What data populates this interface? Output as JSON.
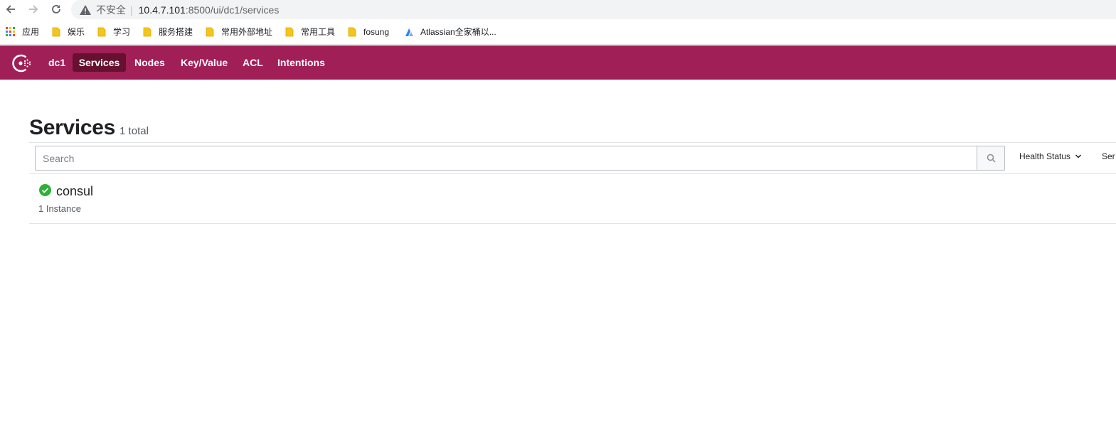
{
  "browser": {
    "security_label": "不安全",
    "separator": "|",
    "url_host": "10.4.7.101",
    "url_path": ":8500/ui/dc1/services",
    "bookmarks": [
      {
        "label": "应用",
        "icon": "apps-grid-icon"
      },
      {
        "label": "娱乐",
        "icon": "folder-icon"
      },
      {
        "label": "学习",
        "icon": "folder-icon"
      },
      {
        "label": "服务搭建",
        "icon": "folder-icon"
      },
      {
        "label": "常用外部地址",
        "icon": "folder-icon"
      },
      {
        "label": "常用工具",
        "icon": "folder-icon"
      },
      {
        "label": "fosung",
        "icon": "folder-icon"
      },
      {
        "label": "Atlassian全家桶以...",
        "icon": "atlassian-icon"
      }
    ]
  },
  "nav": {
    "datacenter": "dc1",
    "items": [
      {
        "label": "Services",
        "active": true
      },
      {
        "label": "Nodes",
        "active": false
      },
      {
        "label": "Key/Value",
        "active": false
      },
      {
        "label": "ACL",
        "active": false
      },
      {
        "label": "Intentions",
        "active": false
      }
    ]
  },
  "page": {
    "title": "Services",
    "count": "1 total"
  },
  "filters": {
    "search_placeholder": "Search",
    "health_status_label": "Health Status",
    "sort_label": "Ser"
  },
  "services": [
    {
      "name": "consul",
      "instances": "1 Instance",
      "status": "passing"
    }
  ],
  "colors": {
    "brand": "#a01f56",
    "brand_active": "#66112f",
    "passing": "#2eb039",
    "folder": "#f5c518"
  }
}
